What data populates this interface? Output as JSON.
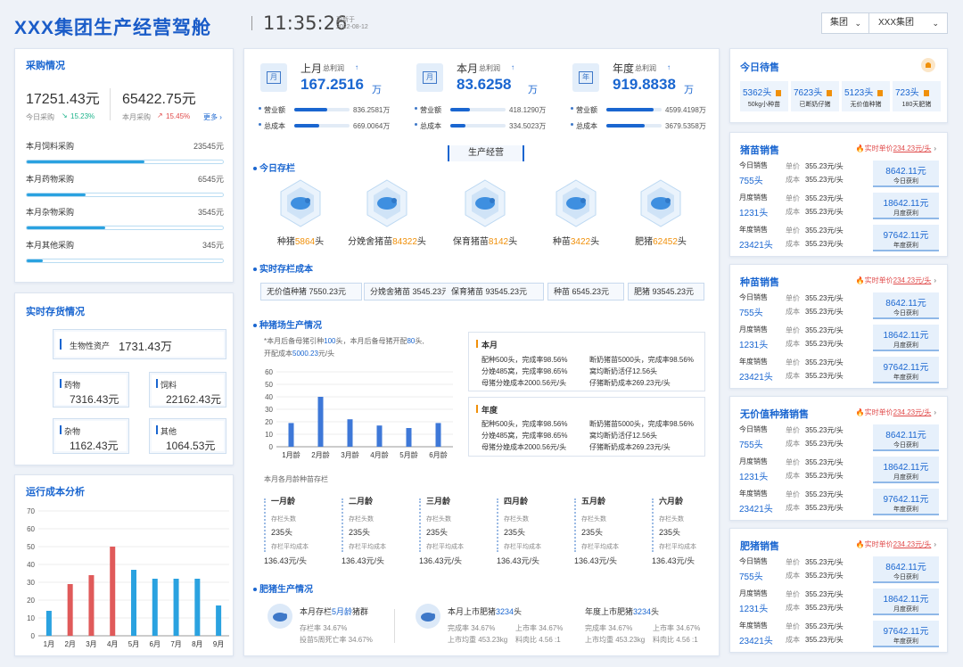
{
  "header": {
    "title": "XXX集团生产经营驾舱",
    "time": "11:35:26",
    "updated_label": "更新于",
    "updated_date": "2022-08-12",
    "select_group_label": "集团",
    "select_company_value": "XXX集团"
  },
  "purchase": {
    "title": "采购情况",
    "today_value": "17251.43元",
    "month_value": "65422.75元",
    "today_label": "今日采购",
    "today_change": "15.23%",
    "month_label": "本月采购",
    "month_change": "15.45%",
    "more_label": "更多",
    "items": [
      {
        "label": "本月饲料采购",
        "value": "23545元",
        "fill": 0.6
      },
      {
        "label": "本月药物采购",
        "value": "6545元",
        "fill": 0.3
      },
      {
        "label": "本月杂物采购",
        "value": "3545元",
        "fill": 0.4
      },
      {
        "label": "本月其他采购",
        "value": "345元",
        "fill": 0.08
      }
    ]
  },
  "inventory": {
    "title": "实时存货情况",
    "bio_label": "生物性资产",
    "bio_value": "1731.43万",
    "drug_label": "药物",
    "drug_value": "7316.43元",
    "feed_label": "饲料",
    "feed_value": "22162.43元",
    "misc_label": "杂物",
    "misc_value": "1162.43元",
    "other_label": "其他",
    "other_value": "1064.53元"
  },
  "cost_chart": {
    "title": "运行成本分析"
  },
  "chart_data": [
    {
      "type": "bar",
      "title": "运行成本分析",
      "categories": [
        "1月",
        "2月",
        "3月",
        "4月",
        "5月",
        "6月",
        "7月",
        "8月",
        "9月"
      ],
      "values": [
        14,
        29,
        34,
        50,
        37,
        32,
        32,
        32,
        17
      ],
      "colors": [
        "#2aa2e0",
        "#e05a5a",
        "#e05a5a",
        "#e05a5a",
        "#2aa2e0",
        "#2aa2e0",
        "#2aa2e0",
        "#2aa2e0",
        "#2aa2e0"
      ],
      "ylim": [
        0,
        70
      ],
      "yticks": [
        0,
        10,
        20,
        30,
        40,
        50,
        60,
        70
      ]
    },
    {
      "type": "bar",
      "title": "",
      "categories": [
        "1月龄",
        "2月龄",
        "3月龄",
        "4月龄",
        "5月龄",
        "6月龄"
      ],
      "values": [
        19,
        40,
        22,
        17,
        15,
        19
      ],
      "ylim": [
        0,
        60
      ],
      "yticks": [
        0,
        10,
        20,
        30,
        40,
        50,
        60
      ]
    }
  ],
  "profit": [
    {
      "title": "上月",
      "sub": "总利润",
      "value": "167.2516",
      "unit": "万",
      "cal": "月",
      "revenue_label": "营业额",
      "revenue": "836.2581万",
      "cost_label": "总成本",
      "cost": "669.0064万",
      "rev_fill": 0.6,
      "cost_fill": 0.45
    },
    {
      "title": "本月",
      "sub": "总利润",
      "value": "83.6258",
      "unit": "万",
      "cal": "月",
      "revenue_label": "营业额",
      "revenue": "418.1290万",
      "cost_label": "总成本",
      "cost": "334.5023万",
      "rev_fill": 0.35,
      "cost_fill": 0.28
    },
    {
      "title": "年度",
      "sub": "总利润",
      "value": "919.8838",
      "unit": "万",
      "cal": "年",
      "revenue_label": "营业额",
      "revenue": "4599.4198万",
      "cost_label": "总成本",
      "cost": "3679.5358万",
      "rev_fill": 0.85,
      "cost_fill": 0.7
    }
  ],
  "production": {
    "tab": "生产经营",
    "stock_title": "今日存栏",
    "stock": [
      {
        "name": "种猪",
        "value": "5864",
        "unit": "头"
      },
      {
        "name": "分娩舍猪苗",
        "value": "84322",
        "unit": "头"
      },
      {
        "name": "保育猪苗",
        "value": "8142",
        "unit": "头"
      },
      {
        "name": "种苗",
        "value": "3422",
        "unit": "头"
      },
      {
        "name": "肥猪",
        "value": "62452",
        "unit": "头"
      }
    ],
    "cost_title": "实时存栏成本",
    "cost_tags": [
      "无价值种猪  7550.23元",
      "分娩舍猪苗 3545.23元",
      "保育猪苗 93545.23元",
      "种苗  6545.23元",
      "肥猪  93545.23元"
    ],
    "breed_title": "种猪场生产情况",
    "breed_note_1a": "*本月后备母猪引种",
    "breed_note_1b": "100",
    "breed_note_1c": "头，本月后备母猪开配",
    "breed_note_1d": "80",
    "breed_note_1e": "头,",
    "breed_note_2a": "开配成本",
    "breed_note_2b": "5000.23",
    "breed_note_2c": "元/头",
    "month_box": {
      "title": "本月",
      "r1a": "配种500头，完成率98.56%",
      "r1b": "断奶猪苗5000头，完成率98.56%",
      "r2a": "分娩485窝，完成率98.65%",
      "r2b": "窝均断奶活仔12.56头",
      "r3a": "母猪分娩成本2000.56元/头",
      "r3b": "仔猪断奶成本269.23元/头"
    },
    "year_box": {
      "title": "年度",
      "r1a": "配种500头，完成率98.56%",
      "r1b": "断奶猪苗5000头，完成率98.56%",
      "r2a": "分娩485窝，完成率98.65%",
      "r2b": "窝均断奶活仔12.56头",
      "r3a": "母猪分娩成本2000.56元/头",
      "r3b": "仔猪断奶成本269.23元/头"
    },
    "age_title": "本月各月龄种苗存栏",
    "ages": [
      {
        "name": "一月龄",
        "k1": "存栏头数",
        "v1": "235头",
        "k2": "存栏平均成本",
        "v2": "136.43元/头"
      },
      {
        "name": "二月龄",
        "k1": "存栏头数",
        "v1": "235头",
        "k2": "存栏平均成本",
        "v2": "136.43元/头"
      },
      {
        "name": "三月龄",
        "k1": "存栏头数",
        "v1": "235头",
        "k2": "存栏平均成本",
        "v2": "136.43元/头"
      },
      {
        "name": "四月龄",
        "k1": "存栏头数",
        "v1": "235头",
        "k2": "存栏平均成本",
        "v2": "136.43元/头"
      },
      {
        "name": "五月龄",
        "k1": "存栏头数",
        "v1": "235头",
        "k2": "存栏平均成本",
        "v2": "136.43元/头"
      },
      {
        "name": "六月龄",
        "k1": "存栏头数",
        "v1": "235头",
        "k2": "存栏平均成本",
        "v2": "136.43元/头"
      }
    ],
    "fat_title": "肥猪生产情况",
    "fat1": {
      "a": "本月存栏",
      "b": "5月龄",
      "c": "猪群",
      "l1": "存栏率 34.67%",
      "l2": "投苗5周死亡率 34.67%"
    },
    "fat2": {
      "a": "本月上市肥猪",
      "b": "3234",
      "c": "头",
      "l1a": "完成率 34.67%",
      "l1b": "上市率  34.67%",
      "l2a": "上市均重  453.23kg",
      "l2b": "料肉比  4.56 :1"
    },
    "fat3": {
      "a": "年度上市肥猪",
      "b": "3234",
      "c": "头",
      "l1a": "完成率 34.67%",
      "l1b": "上市率  34.67%",
      "l2a": "上市均重  453.23kg",
      "l2b": "料肉比  4.56 :1"
    }
  },
  "todo": {
    "title": "今日待售",
    "items": [
      {
        "value": "5362头",
        "label": "50kg小种苗"
      },
      {
        "value": "7623头",
        "label": "已断奶仔猪"
      },
      {
        "value": "5123头",
        "label": "无价值种猪"
      },
      {
        "value": "723头",
        "label": "180天肥猪"
      }
    ]
  },
  "sales": [
    {
      "title": "猪苗销售",
      "price_label": "实时单价",
      "price": "234.23元/头",
      "rows": [
        {
          "l1": "今日销售",
          "l2": "755头",
          "k1": "单价",
          "v1": "355.23元/头",
          "k2": "成本",
          "v2": "355.23元/头",
          "box": "8642.11元",
          "box_label": "今日获利"
        },
        {
          "l1": "月度销售",
          "l2": "1231头",
          "k1": "单价",
          "v1": "355.23元/头",
          "k2": "成本",
          "v2": "355.23元/头",
          "box": "18642.11元",
          "box_label": "月度获利"
        },
        {
          "l1": "年度销售",
          "l2": "23421头",
          "k1": "单价",
          "v1": "355.23元/头",
          "k2": "成本",
          "v2": "355.23元/头",
          "box": "97642.11元",
          "box_label": "年度获利"
        }
      ]
    },
    {
      "title": "种苗销售",
      "price_label": "实时单价",
      "price": "234.23元/头",
      "rows": [
        {
          "l1": "今日销售",
          "l2": "755头",
          "k1": "单价",
          "v1": "355.23元/头",
          "k2": "成本",
          "v2": "355.23元/头",
          "box": "8642.11元",
          "box_label": "今日获利"
        },
        {
          "l1": "月度销售",
          "l2": "1231头",
          "k1": "单价",
          "v1": "355.23元/头",
          "k2": "成本",
          "v2": "355.23元/头",
          "box": "18642.11元",
          "box_label": "月度获利"
        },
        {
          "l1": "年度销售",
          "l2": "23421头",
          "k1": "单价",
          "v1": "355.23元/头",
          "k2": "成本",
          "v2": "355.23元/头",
          "box": "97642.11元",
          "box_label": "年度获利"
        }
      ]
    },
    {
      "title": "无价值种猪销售",
      "price_label": "实时单价",
      "price": "234.23元/头",
      "rows": [
        {
          "l1": "今日销售",
          "l2": "755头",
          "k1": "单价",
          "v1": "355.23元/头",
          "k2": "成本",
          "v2": "355.23元/头",
          "box": "8642.11元",
          "box_label": "今日获利"
        },
        {
          "l1": "月度销售",
          "l2": "1231头",
          "k1": "单价",
          "v1": "355.23元/头",
          "k2": "成本",
          "v2": "355.23元/头",
          "box": "18642.11元",
          "box_label": "月度获利"
        },
        {
          "l1": "年度销售",
          "l2": "23421头",
          "k1": "单价",
          "v1": "355.23元/头",
          "k2": "成本",
          "v2": "355.23元/头",
          "box": "97642.11元",
          "box_label": "年度获利"
        }
      ]
    },
    {
      "title": "肥猪销售",
      "price_label": "实时单价",
      "price": "234.23元/头",
      "rows": [
        {
          "l1": "今日销售",
          "l2": "755头",
          "k1": "单价",
          "v1": "355.23元/头",
          "k2": "成本",
          "v2": "355.23元/头",
          "box": "8642.11元",
          "box_label": "今日获利"
        },
        {
          "l1": "月度销售",
          "l2": "1231头",
          "k1": "单价",
          "v1": "355.23元/头",
          "k2": "成本",
          "v2": "355.23元/头",
          "box": "18642.11元",
          "box_label": "月度获利"
        },
        {
          "l1": "年度销售",
          "l2": "23421头",
          "k1": "单价",
          "v1": "355.23元/头",
          "k2": "成本",
          "v2": "355.23元/头",
          "box": "97642.11元",
          "box_label": "年度获利"
        }
      ]
    }
  ]
}
